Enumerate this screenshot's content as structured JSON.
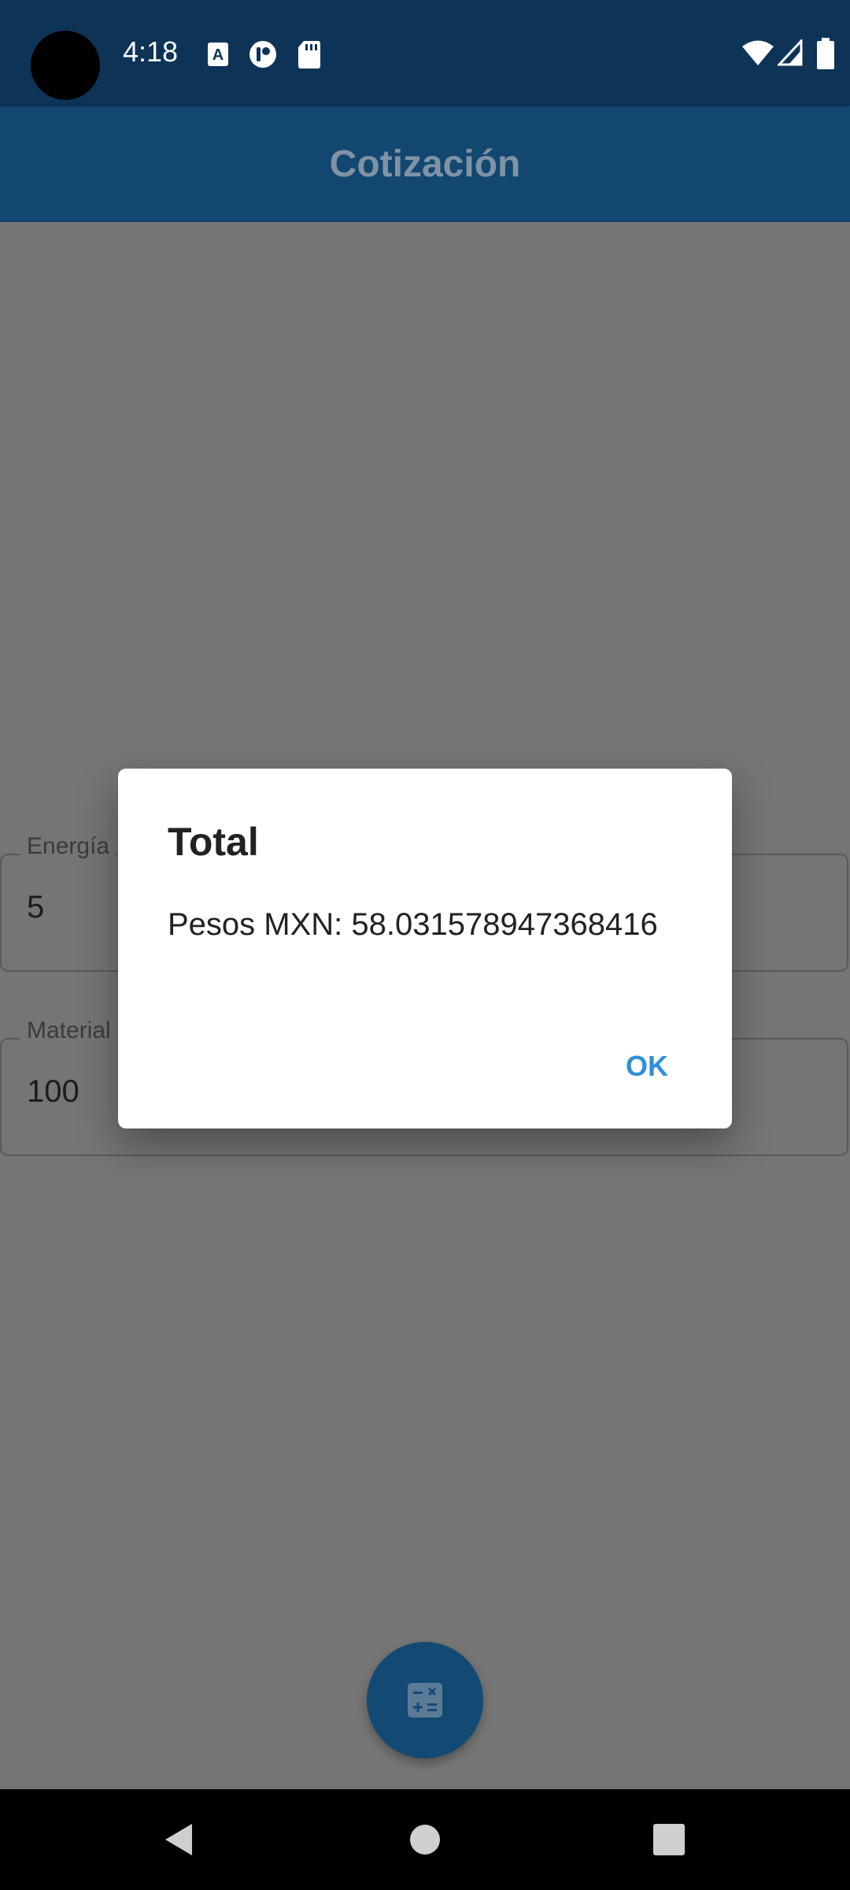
{
  "status_bar": {
    "time": "4:18",
    "left_icons": [
      "a-accessibility-icon",
      "fit-tracker-icon",
      "sd-card-icon"
    ],
    "right_icons": [
      "wifi-icon",
      "signal-icon",
      "battery-icon"
    ]
  },
  "app_bar": {
    "title": "Cotización"
  },
  "form": {
    "fields": [
      {
        "label": "Energía",
        "value": "5"
      },
      {
        "label": "Material",
        "value": "100"
      }
    ]
  },
  "fab": {
    "icon": "calculator-icon"
  },
  "dialog": {
    "title": "Total",
    "message": "Pesos MXN: 58.031578947368416",
    "ok_label": "OK"
  },
  "nav": {
    "buttons": [
      "back-icon",
      "home-icon",
      "recents-icon"
    ]
  },
  "colors": {
    "status_bar": "#0d3357",
    "app_bar": "#124770",
    "accent": "#2f8fd8",
    "scrim_background": "#757575"
  }
}
